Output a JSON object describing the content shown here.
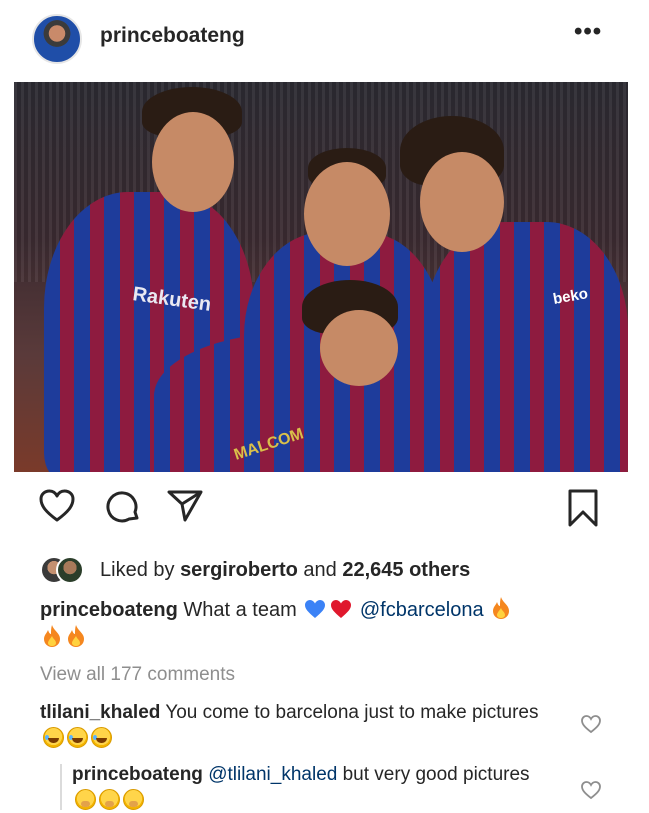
{
  "post": {
    "username": "princeboateng",
    "more_label": "•••"
  },
  "photo": {
    "jersey_sponsor": "Rakuten",
    "sleeve_sponsor": "beko",
    "back_name": "MALCOM"
  },
  "likes": {
    "prefix": "Liked by ",
    "user": "sergiroberto",
    "middle": " and ",
    "count": "22,645 others"
  },
  "caption": {
    "username": "princeboateng",
    "text": "What a team",
    "mention": "@fcbarcelona"
  },
  "view_all_comments": "View all 177 comments",
  "comments": [
    {
      "username": "tlilani_khaled",
      "text": "You come to barcelona just to make pictures"
    },
    {
      "username": "princeboateng",
      "mention": "@tlilani_khaled",
      "text": "but very good pictures"
    }
  ],
  "colors": {
    "text": "#262626",
    "muted": "#8e8e8e",
    "link": "#003569",
    "blue_heart": "#3b82f6",
    "red_heart": "#e0182d",
    "fire": "#f5871f"
  },
  "icons": [
    "more-icon",
    "heart-icon",
    "comment-icon",
    "share-icon",
    "bookmark-icon"
  ]
}
